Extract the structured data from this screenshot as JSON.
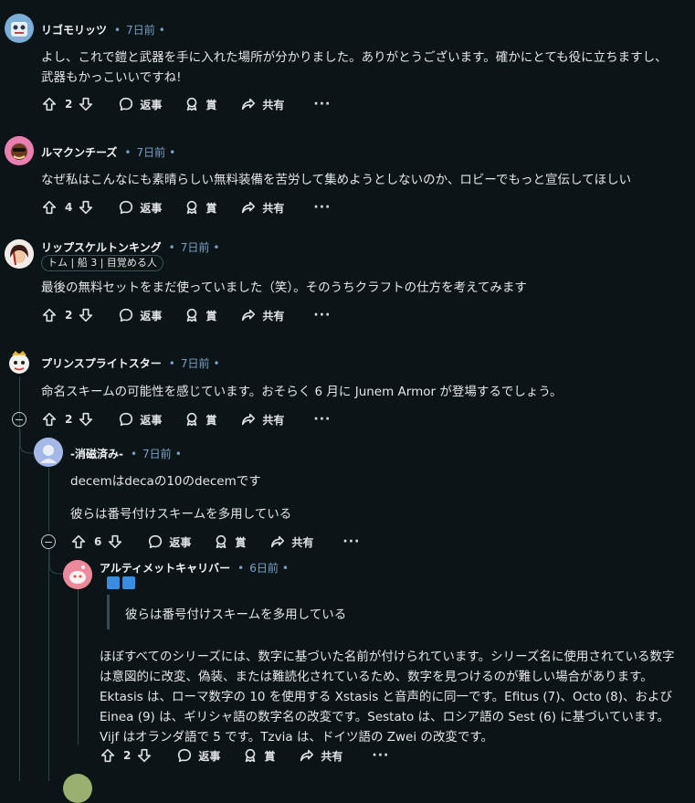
{
  "actions": {
    "reply": "返事",
    "award": "賞",
    "share": "共有",
    "more": "···"
  },
  "comments": [
    {
      "user": "リゴモリッツ",
      "time": "7日前",
      "text": "よし、これで鎧と武器を手に入れた場所が分かりました。ありがとうございます。確かにとても役に立ちますし、武器もかっこいいですね!",
      "votes": "2"
    },
    {
      "user": "ルマクンチーズ",
      "time": "7日前",
      "text": "なぜ私はこんなにも素晴らしい無料装備を苦労して集めようとしないのか、ロビーでもっと宣伝してほしい",
      "votes": "4"
    },
    {
      "user": "リップスケルトンキング",
      "time": "7日前",
      "flair": "トム | 船 3 | 目覚める人",
      "text": "最後の無料セットをまだ使っていました（笑）。そのうちクラフトの仕方を考えてみます",
      "votes": "2"
    },
    {
      "user": "プリンスプライトスター",
      "time": "7日前",
      "text": "命名スキームの可能性を感じています。おそらく 6 月に Junem Armor が登場するでしょう。",
      "votes": "2"
    },
    {
      "user": "-消磁済み-",
      "time": "7日前",
      "text1": "decemはdecaの10のdecemです",
      "text2": "彼らは番号付けスキームを多用している",
      "votes": "6"
    },
    {
      "user": "アルティメットキャリバー",
      "time": "6日前",
      "quote": "彼らは番号付けスキームを多用している",
      "text": "ほぼすべてのシリーズには、数字に基づいた名前が付けられています。シリーズ名に使用されている数字は意図的に改変、偽装、または難読化されているため、数字を見つけるのが難しい場合があります。Ektasis は、ローマ数字の 10 を使用する Xstasis と音声的に同一です。Efitus (7)、Octo (8)、および Einea (9) は、ギリシャ語の数字名の改変です。Sestato は、ロシア語の Sest (6) に基づいています。Vijf はオランダ語で 5 です。Tzvia は、ドイツ語の Zwei の改変です。",
      "votes": "2"
    }
  ]
}
